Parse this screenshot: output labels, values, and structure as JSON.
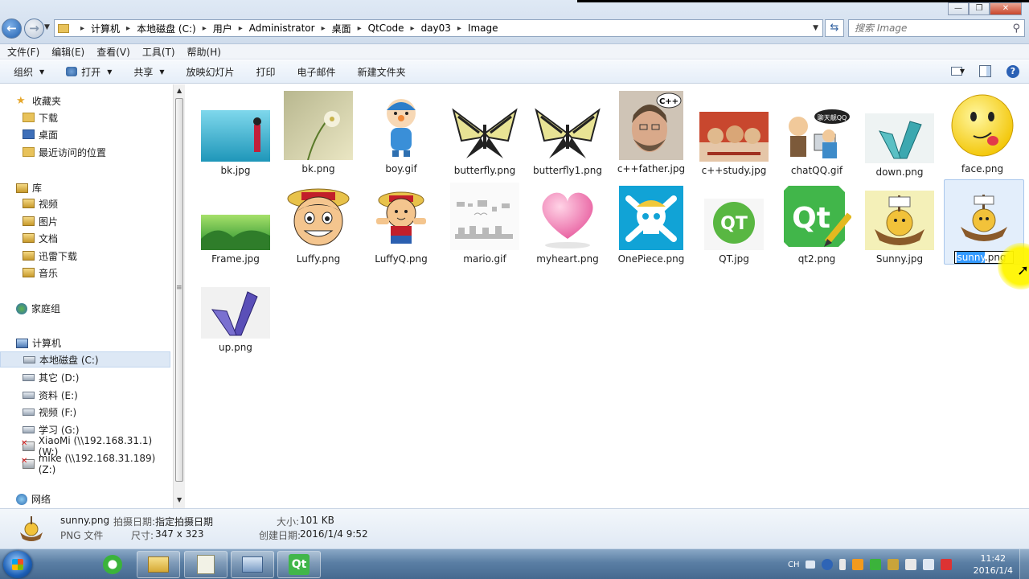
{
  "window": {
    "controls": [
      "—",
      "❐",
      "✕"
    ]
  },
  "address": {
    "crumbs": [
      "计算机",
      "本地磁盘 (C:)",
      "用户",
      "Administrator",
      "桌面",
      "QtCode",
      "day03",
      "Image"
    ],
    "search_placeholder": "搜索 Image"
  },
  "menu": [
    "文件(F)",
    "编辑(E)",
    "查看(V)",
    "工具(T)",
    "帮助(H)"
  ],
  "toolbar": {
    "organize": "组织",
    "open": "打开",
    "share": "共享",
    "slideshow": "放映幻灯片",
    "print": "打印",
    "email": "电子邮件",
    "new_folder": "新建文件夹"
  },
  "sidebar": {
    "favorites": "收藏夹",
    "favorites_items": [
      "下载",
      "桌面",
      "最近访问的位置"
    ],
    "libraries": "库",
    "library_items": [
      "视频",
      "图片",
      "文档",
      "迅雷下载",
      "音乐"
    ],
    "homegroup": "家庭组",
    "computer": "计算机",
    "computer_items": [
      "本地磁盘 (C:)",
      "其它 (D:)",
      "资料 (E:)",
      "视频 (F:)",
      "学习 (G:)",
      "XiaoMi (\\\\192.168.31.1) (W:)",
      "mike (\\\\192.168.31.189) (Z:)"
    ],
    "network": "网络"
  },
  "files": [
    {
      "name": "bk.jpg",
      "thumb": "cyan-girl"
    },
    {
      "name": "bk.png",
      "thumb": "flower"
    },
    {
      "name": "boy.gif",
      "thumb": "pocoyo"
    },
    {
      "name": "butterfly.png",
      "thumb": "butterfly"
    },
    {
      "name": "butterfly1.png",
      "thumb": "butterfly"
    },
    {
      "name": "c++father.jpg",
      "thumb": "portrait"
    },
    {
      "name": "c++study.jpg",
      "thumb": "poster"
    },
    {
      "name": "chatQQ.gif",
      "thumb": "cartoon"
    },
    {
      "name": "down.png",
      "thumb": "teal-butterfly"
    },
    {
      "name": "face.png",
      "thumb": "smiley"
    },
    {
      "name": "Frame.jpg",
      "thumb": "green"
    },
    {
      "name": "Luffy.png",
      "thumb": "luffy"
    },
    {
      "name": "LuffyQ.png",
      "thumb": "luffyq"
    },
    {
      "name": "mario.gif",
      "thumb": "sprites"
    },
    {
      "name": "myheart.png",
      "thumb": "heart"
    },
    {
      "name": "OnePiece.png",
      "thumb": "jolly-roger"
    },
    {
      "name": "QT.jpg",
      "thumb": "qt-round"
    },
    {
      "name": "qt2.png",
      "thumb": "qt-logo"
    },
    {
      "name": "Sunny.jpg",
      "thumb": "ship"
    },
    {
      "name": "sunny.png",
      "thumb": "ship"
    },
    {
      "name": "up.png",
      "thumb": "purple-butterfly"
    }
  ],
  "thumb_text": {
    "cpp_badge": "C++",
    "chat_bubble": "聊天靓QQ",
    "qt_round": "QT",
    "qt_logo": "Qt"
  },
  "rename": {
    "selected_part": "sunny",
    "rest": ".png"
  },
  "details": {
    "filename": "sunny.png",
    "filetype": "PNG 文件",
    "date_taken_label": "拍摄日期:",
    "date_taken_value": "指定拍摄日期",
    "dimensions_label": "尺寸:",
    "dimensions_value": "347 x 323",
    "size_label": "大小:",
    "size_value": "101 KB",
    "created_label": "创建日期:",
    "created_value": "2016/1/4 9:52"
  },
  "taskbar": {
    "lang": "CH",
    "time": "11:42",
    "date": "2016/1/4"
  },
  "colors": {
    "accent": "#3399ff",
    "selection_bg": "#e3eefb",
    "taskbar": "#5a7ea4"
  }
}
